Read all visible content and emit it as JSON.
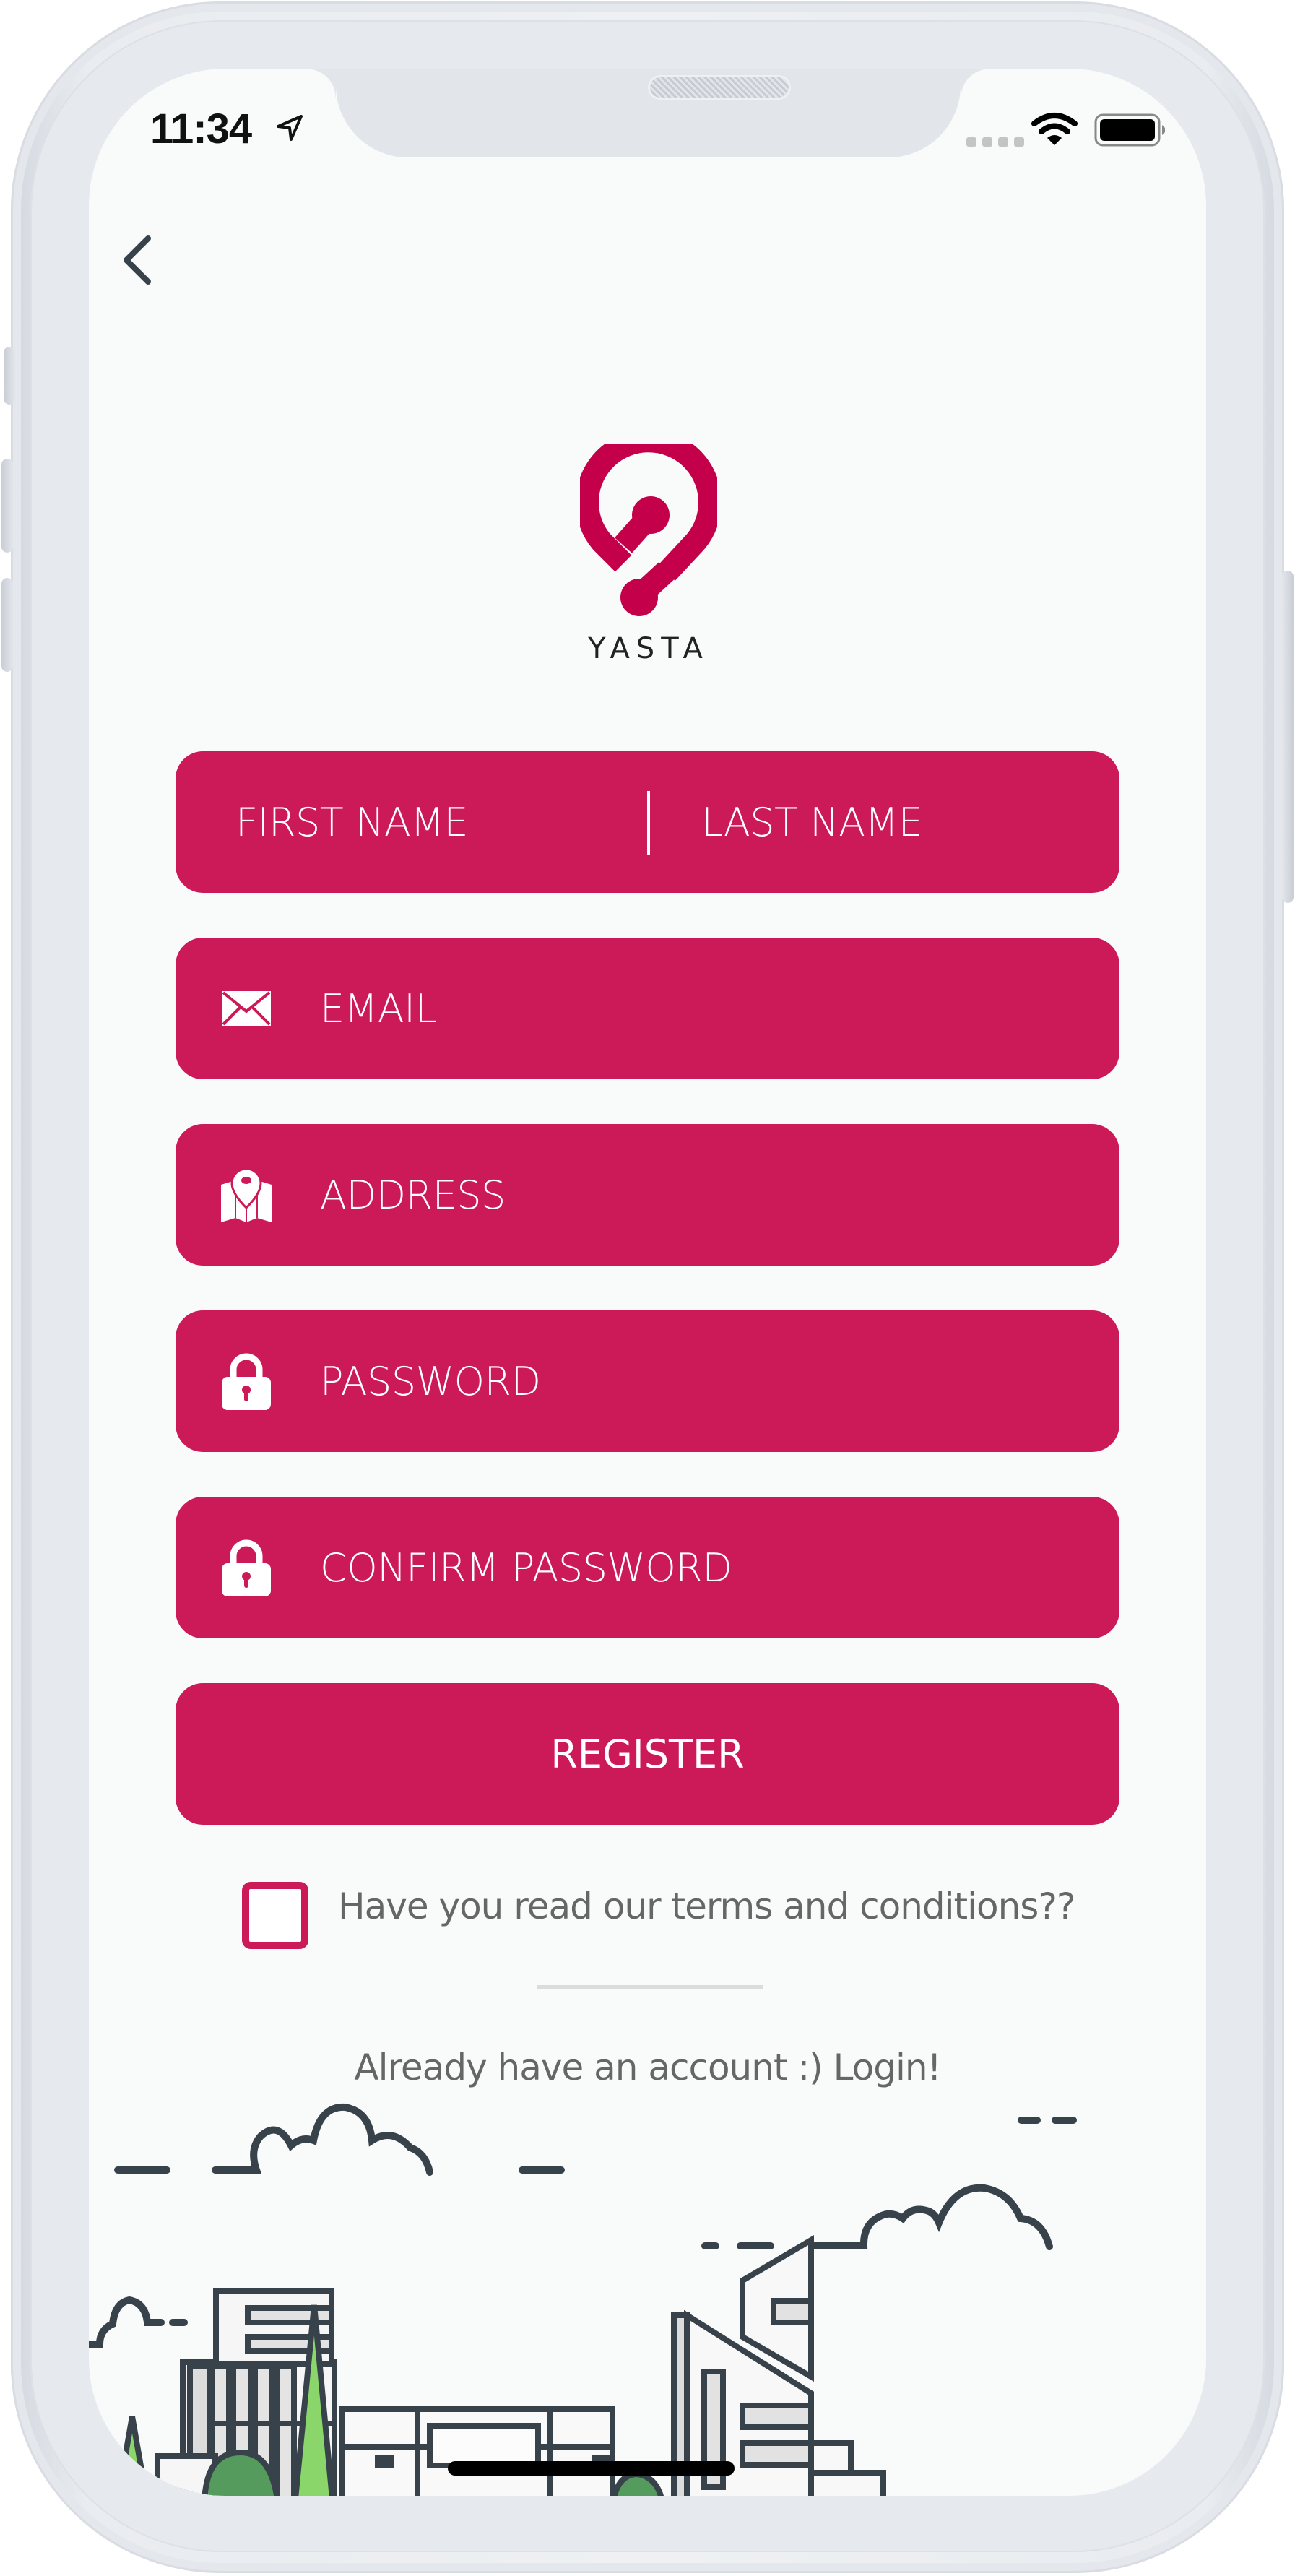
{
  "status_bar": {
    "time": "11:34",
    "location_icon": "location-arrow-icon",
    "signal_icon": "signal-dots-icon",
    "wifi_icon": "wifi-icon",
    "battery_icon": "battery-full-icon"
  },
  "nav": {
    "back_icon": "chevron-left-icon"
  },
  "brand": {
    "name": "YASTA",
    "logo_icon": "yasta-pin-logo",
    "color": "#c4004a"
  },
  "form": {
    "first_name_placeholder": "FIRST NAME",
    "last_name_placeholder": "LAST NAME",
    "fields": [
      {
        "placeholder": "EMAIL",
        "icon": "envelope-icon"
      },
      {
        "placeholder": "ADDRESS",
        "icon": "map-pin-icon"
      },
      {
        "placeholder": "PASSWORD",
        "icon": "padlock-icon"
      },
      {
        "placeholder": "CONFIRM PASSWORD",
        "icon": "padlock-icon"
      }
    ],
    "register_label": "REGISTER",
    "terms_label": "Have you read our terms and conditions??",
    "terms_checked": false,
    "login_link": "Already have an account :) Login!"
  },
  "theme": {
    "accent": "#cc1957",
    "background": "#f9fafa",
    "muted_text": "#666666",
    "illustration_stroke": "#37424a",
    "tree_light": "#8bd66a",
    "tree_dark": "#559b5d"
  }
}
